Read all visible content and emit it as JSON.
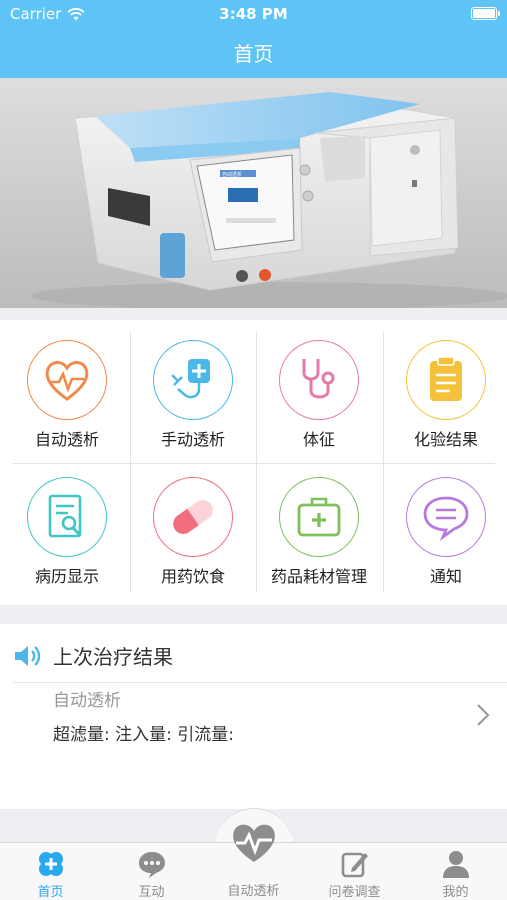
{
  "status_bar": {
    "carrier": "Carrier",
    "time": "3:48 PM",
    "battery_level": 1.0
  },
  "nav": {
    "title": "首页"
  },
  "hero": {
    "device_screen_text": "自动透析"
  },
  "grid": {
    "items": [
      {
        "label": "自动透析",
        "icon": "heart-pulse-icon",
        "color": "#f08a4b"
      },
      {
        "label": "手动透析",
        "icon": "manual-dialysis-icon",
        "color": "#4ab8e8"
      },
      {
        "label": "体征",
        "icon": "stethoscope-icon",
        "color": "#e57aa8"
      },
      {
        "label": "化验结果",
        "icon": "clipboard-icon",
        "color": "#f4c23a"
      },
      {
        "label": "病历显示",
        "icon": "medical-record-icon",
        "color": "#3fc6c4"
      },
      {
        "label": "用药饮食",
        "icon": "capsule-icon",
        "color": "#f26d7d"
      },
      {
        "label": "药品耗材管理",
        "icon": "medical-kit-icon",
        "color": "#7dc15b"
      },
      {
        "label": "通知",
        "icon": "message-icon",
        "color": "#b67adf"
      }
    ]
  },
  "last_result": {
    "title": "上次治疗结果",
    "mode": "自动透析",
    "stats": "超滤量: 注入量: 引流量:"
  },
  "tabbar": {
    "tabs": [
      {
        "label": "首页",
        "icon": "home-cross-icon",
        "active": true
      },
      {
        "label": "互动",
        "icon": "chat-icon",
        "active": false
      },
      {
        "label": "自动透析",
        "icon": "heart-pulse-icon",
        "active": false
      },
      {
        "label": "问卷调查",
        "icon": "survey-edit-icon",
        "active": false
      },
      {
        "label": "我的",
        "icon": "user-icon",
        "active": false
      }
    ]
  },
  "colors": {
    "primary": "#5ec4f5",
    "tab_active": "#29a8f0",
    "tab_inactive": "#8d8d8d"
  }
}
